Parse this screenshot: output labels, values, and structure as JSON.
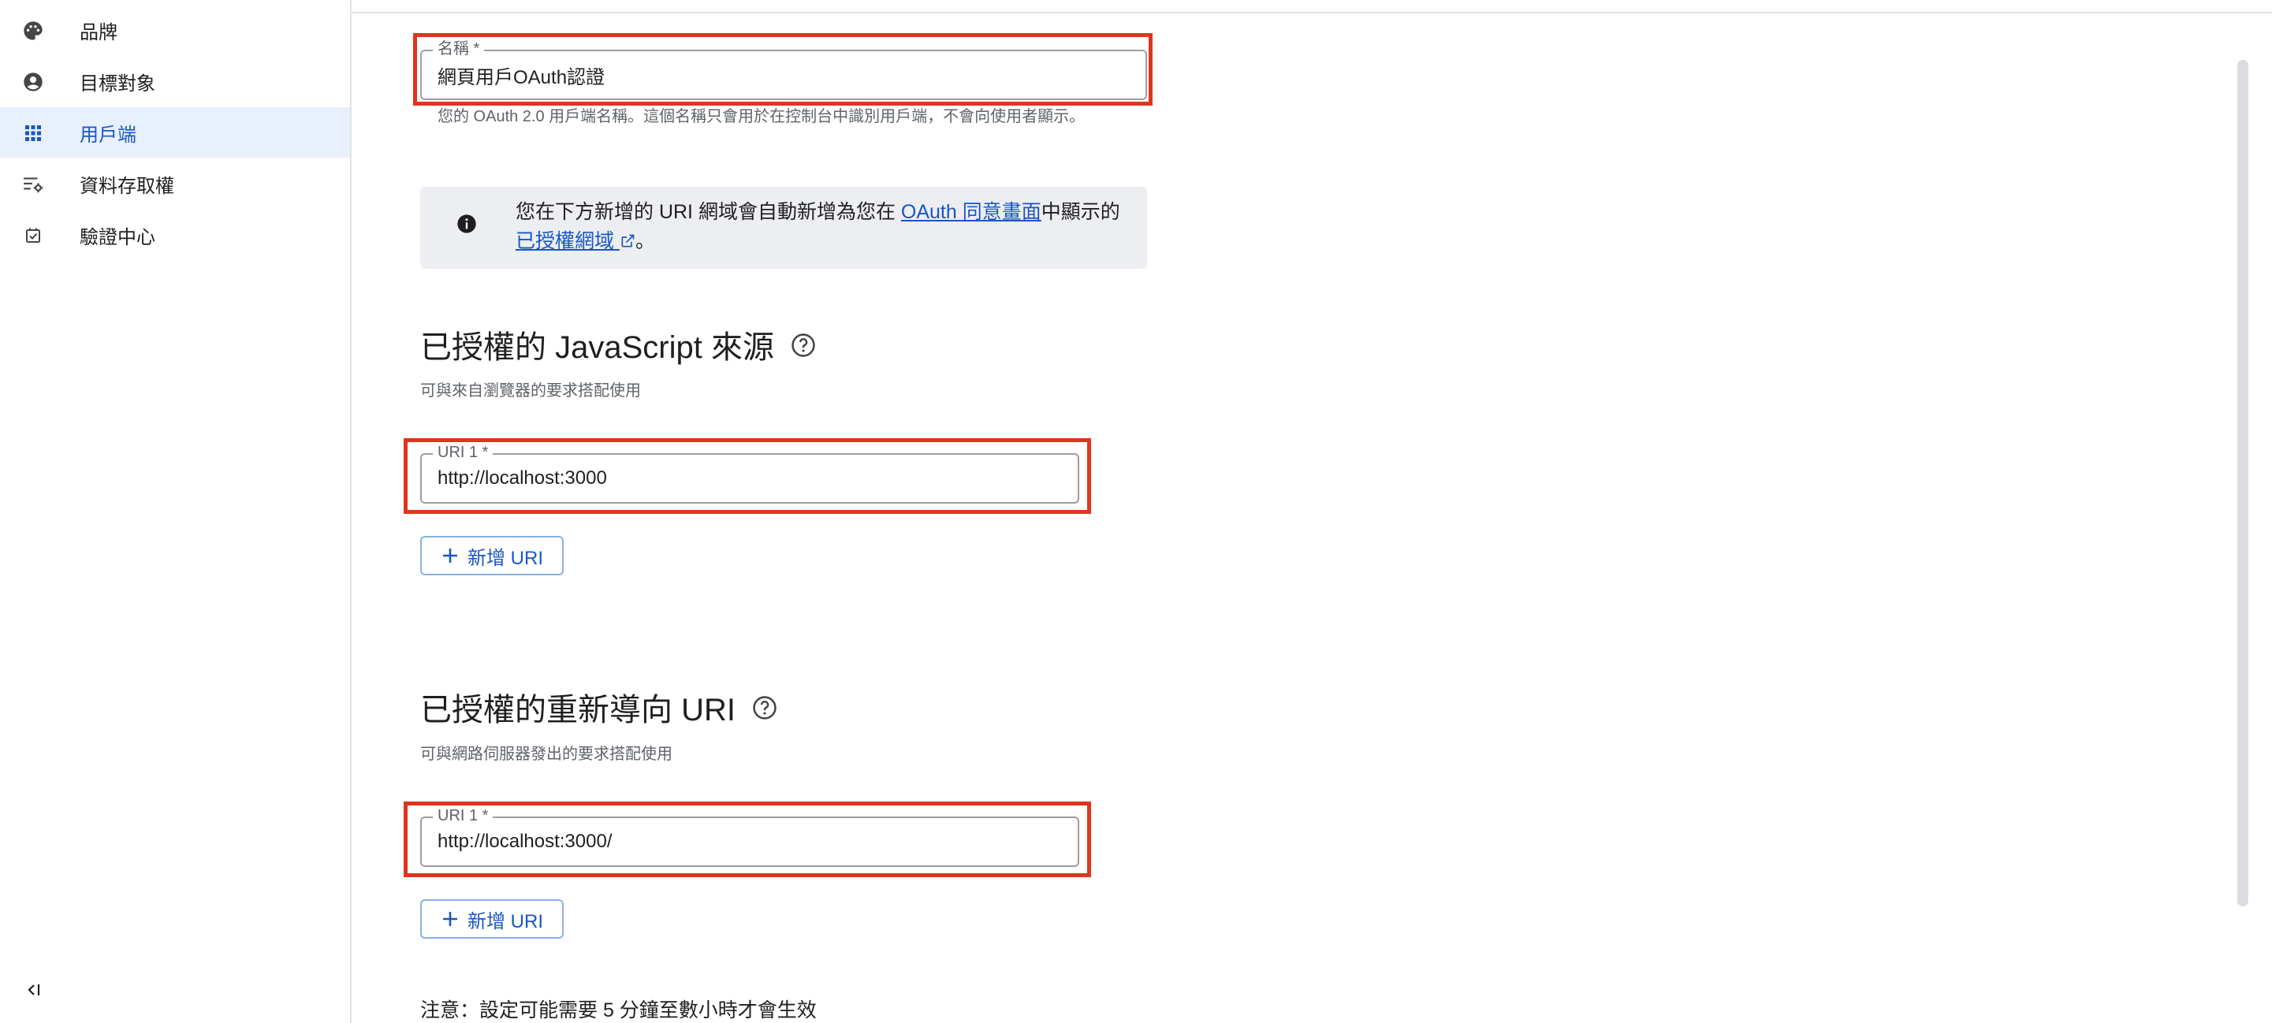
{
  "sidebar": {
    "items": [
      {
        "label": "品牌",
        "icon": "palette-icon"
      },
      {
        "label": "目標對象",
        "icon": "account-circle-icon"
      },
      {
        "label": "用戶端",
        "icon": "apps-grid-icon",
        "active": true
      },
      {
        "label": "資料存取權",
        "icon": "list-settings-icon"
      },
      {
        "label": "驗證中心",
        "icon": "verified-checkbox-icon"
      }
    ],
    "collapse_icon": "collapse-sidebar-icon"
  },
  "name_field": {
    "label": "名稱 *",
    "value": "網頁用戶OAuth認證",
    "helper": "您的 OAuth 2.0 用戶端名稱。這個名稱只會用於在控制台中識別用戶端，不會向使用者顯示。"
  },
  "info_box": {
    "icon": "info-icon",
    "text_before": "您在下方新增的 URI 網域會自動新增為您在",
    "link1": "OAuth 同意畫面",
    "text_middle": "中顯示的",
    "link2": "已授權網域",
    "text_after": "。"
  },
  "js_origins": {
    "title": "已授權的 JavaScript 來源",
    "subtitle": "可與來自瀏覽器的要求搭配使用",
    "uri_label": "URI 1 *",
    "uri_value": "http://localhost:3000",
    "add_button": "新增 URI"
  },
  "redirect_uris": {
    "title": "已授權的重新導向 URI",
    "subtitle": "可與網路伺服器發出的要求搭配使用",
    "uri_label": "URI 1 *",
    "uri_value": "http://localhost:3000/",
    "add_button": "新增 URI"
  },
  "note": "注意：設定可能需要 5 分鐘至數小時才會生效",
  "colors": {
    "accent": "#1a56c4",
    "active_bg": "#e8f0fe",
    "highlight": "#e0341e",
    "info_bg": "#eceef2"
  }
}
